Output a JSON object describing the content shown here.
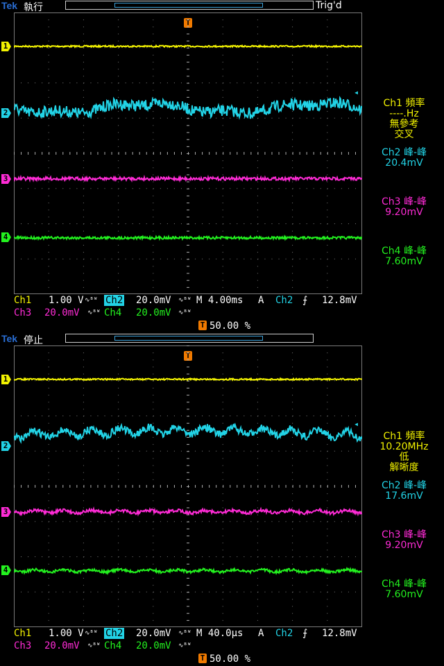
{
  "colors": {
    "ch1": "#f2f200",
    "ch2": "#22d3e6",
    "ch3": "#ff2bd6",
    "ch4": "#23f21f",
    "grid": "#7a7a7a",
    "trigger": "#f07a00"
  },
  "screens": [
    {
      "logo": "Tek",
      "run_state": "執行",
      "trig_status": "Trig'd",
      "trigger_marker": "T",
      "channel_markers": [
        "1",
        "2",
        "3",
        "4"
      ],
      "measurements": {
        "ch1": {
          "label": "Ch1 頻率",
          "value": "----.Hz",
          "note1": "無參考",
          "note2": "交叉"
        },
        "ch2": {
          "label": "Ch2 峰-峰",
          "value": "20.4mV"
        },
        "ch3": {
          "label": "Ch3 峰-峰",
          "value": "9.20mV"
        },
        "ch4": {
          "label": "Ch4 峰-峰",
          "value": "7.60mV"
        }
      },
      "readout": {
        "ch1": "Ch1",
        "ch1_scale": "1.00 V",
        "ch2": "Ch2",
        "ch2_scale": "20.0mV",
        "ch3": "Ch3",
        "ch3_scale": "20.0mV",
        "ch4": "Ch4",
        "ch4_scale": "20.0mV",
        "bw_symbol": "∿ᴮᵂ",
        "timebase": "M 4.00ms",
        "acq_mode": "A",
        "trig_source": "Ch2",
        "trig_slope": "⨍",
        "trig_level": "12.8mV",
        "trig_position": "50.00 %"
      },
      "traces": {
        "ch1": {
          "level": 0.12,
          "noise": 0.006,
          "mode": "flat"
        },
        "ch2": {
          "level": 0.34,
          "noise": 0.045,
          "mode": "slow"
        },
        "ch3": {
          "level": 0.59,
          "noise": 0.012,
          "mode": "flat"
        },
        "ch4": {
          "level": 0.8,
          "noise": 0.01,
          "mode": "flat"
        }
      }
    },
    {
      "logo": "Tek",
      "run_state": "停止",
      "trig_status": "",
      "trigger_marker": "T",
      "channel_markers": [
        "1",
        "2",
        "3",
        "4"
      ],
      "measurements": {
        "ch1": {
          "label": "Ch1 頻率",
          "value": "10.20MHz",
          "note1": "低",
          "note2": "解晰度"
        },
        "ch2": {
          "label": "Ch2 峰-峰",
          "value": "17.6mV"
        },
        "ch3": {
          "label": "Ch3 峰-峰",
          "value": "9.20mV"
        },
        "ch4": {
          "label": "Ch4 峰-峰",
          "value": "7.60mV"
        }
      },
      "readout": {
        "ch1": "Ch1",
        "ch1_scale": "1.00 V",
        "ch2": "Ch2",
        "ch2_scale": "20.0mV",
        "ch3": "Ch3",
        "ch3_scale": "20.0mV",
        "ch4": "Ch4",
        "ch4_scale": "20.0mV",
        "bw_symbol": "∿ᴮᵂ",
        "timebase": "M 40.0µs",
        "acq_mode": "A",
        "trig_source": "Ch2",
        "trig_slope": "⨍",
        "trig_level": "12.8mV",
        "trig_position": "50.00 %"
      },
      "traces": {
        "ch1": {
          "level": 0.12,
          "noise": 0.006,
          "mode": "flat"
        },
        "ch2": {
          "level": 0.32,
          "noise": 0.03,
          "mode": "ripple"
        },
        "ch3": {
          "level": 0.59,
          "noise": 0.012,
          "mode": "ripple"
        },
        "ch4": {
          "level": 0.8,
          "noise": 0.01,
          "mode": "ripple"
        }
      }
    }
  ]
}
